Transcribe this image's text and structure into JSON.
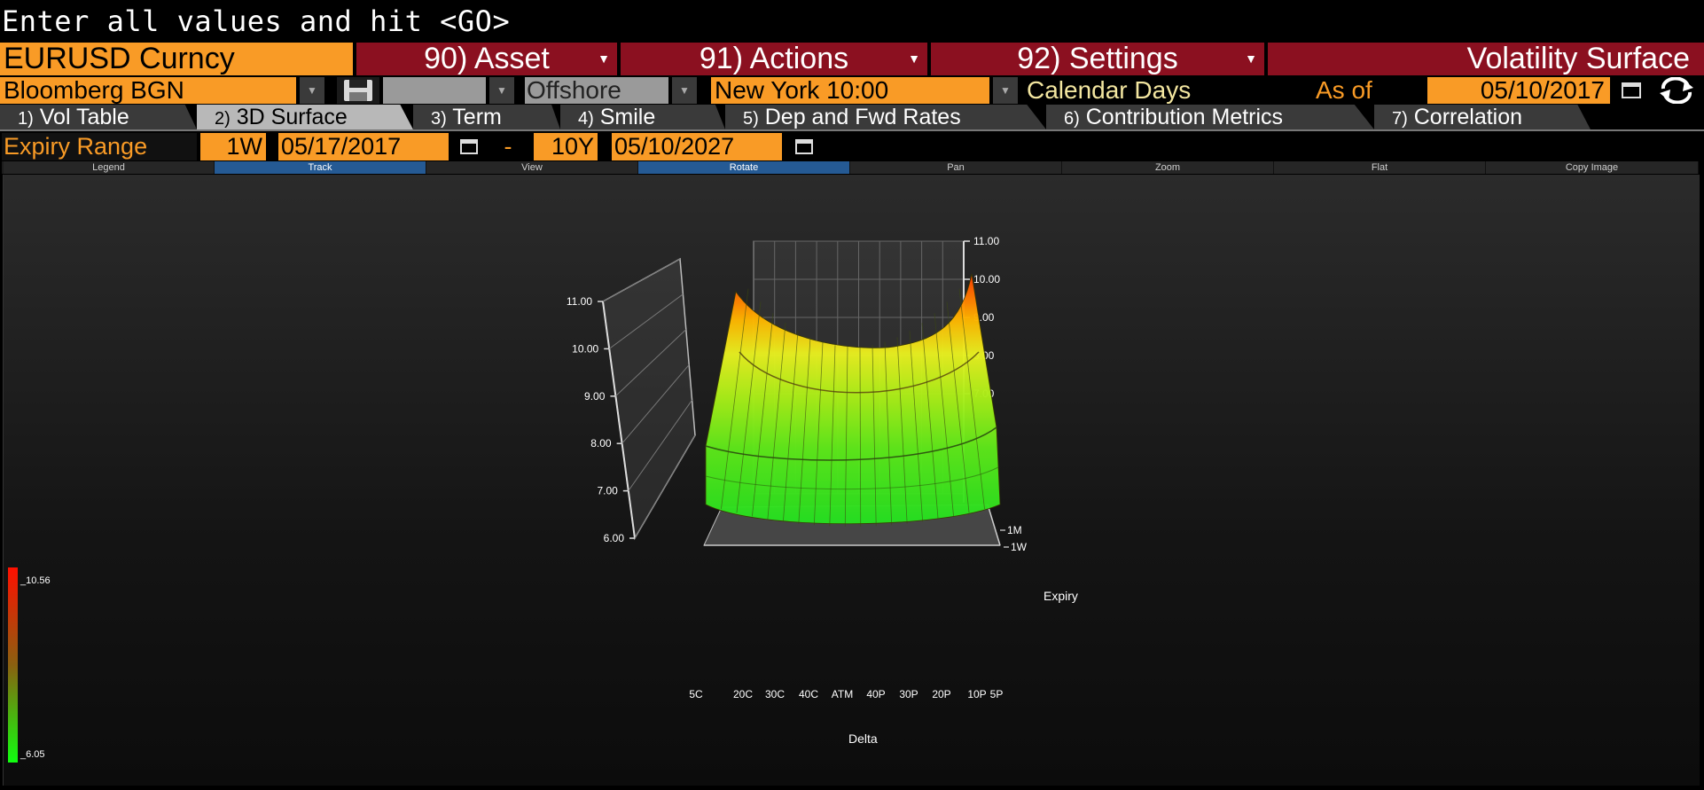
{
  "command_line": "Enter all values and hit <GO>",
  "menu": {
    "security": "EURUSD Curncy",
    "asset": "90) Asset",
    "actions": "91) Actions",
    "settings": "92) Settings",
    "title": "Volatility Surface"
  },
  "controls": {
    "source": "Bloomberg BGN",
    "source_placeholder": "",
    "market": "Offshore",
    "snap_time": "New York 10:00",
    "day_basis": "Calendar Days",
    "as_of_label": "As of",
    "as_of_date": "05/10/2017"
  },
  "tabs": [
    {
      "num": "1)",
      "label": "Vol Table",
      "active": false
    },
    {
      "num": "2)",
      "label": "3D Surface",
      "active": true
    },
    {
      "num": "3)",
      "label": "Term",
      "active": false
    },
    {
      "num": "4)",
      "label": "Smile",
      "active": false
    },
    {
      "num": "5)",
      "label": "Dep and Fwd Rates",
      "active": false
    },
    {
      "num": "6)",
      "label": "Contribution Metrics",
      "active": false
    },
    {
      "num": "7)",
      "label": "Correlation",
      "active": false
    }
  ],
  "expiry": {
    "label": "Expiry Range",
    "from_tenor": "1W",
    "from_date": "05/17/2017",
    "separator": "-",
    "to_tenor": "10Y",
    "to_date": "05/10/2027"
  },
  "toolbar": [
    {
      "label": "Legend",
      "active": false
    },
    {
      "label": "Track",
      "active": true
    },
    {
      "label": "View",
      "active": false
    },
    {
      "label": "Rotate",
      "active": true
    },
    {
      "label": "Pan",
      "active": false
    },
    {
      "label": "Zoom",
      "active": false
    },
    {
      "label": "Flat",
      "active": false
    },
    {
      "label": "Copy Image",
      "active": false
    }
  ],
  "colors": {
    "accent_orange": "#f99b26",
    "menu_red": "#8b1020",
    "active_toolbar": "#255a94",
    "surface_high": "#ff2a00",
    "surface_low": "#1cff10"
  },
  "chart_data": {
    "type": "surface",
    "xlabel": "Delta",
    "ylabel": "Expiry",
    "zlim": [
      6.0,
      11.0
    ],
    "z_ticks": [
      "11.00",
      "10.00",
      "9.00",
      "8.00",
      "7.00",
      "6.00"
    ],
    "back_z_ticks": [
      "11.00",
      "10.00",
      "9.00",
      "8.00",
      "7.00"
    ],
    "x_categories": [
      "5C",
      "20C",
      "30C",
      "40C",
      "ATM",
      "40P",
      "30P",
      "20P",
      "10P",
      "5P"
    ],
    "y_visible_tenors": [
      "1M",
      "1W"
    ],
    "colorbar": {
      "max": "_10.56",
      "min": "_6.05"
    },
    "smile_front_approx": [
      7.9,
      7.3,
      7.0,
      6.8,
      6.7,
      6.7,
      6.8,
      7.0,
      7.3,
      7.9
    ],
    "smile_back_approx": [
      10.4,
      9.3,
      8.6,
      8.2,
      8.0,
      8.0,
      8.2,
      8.6,
      9.3,
      10.56
    ]
  }
}
